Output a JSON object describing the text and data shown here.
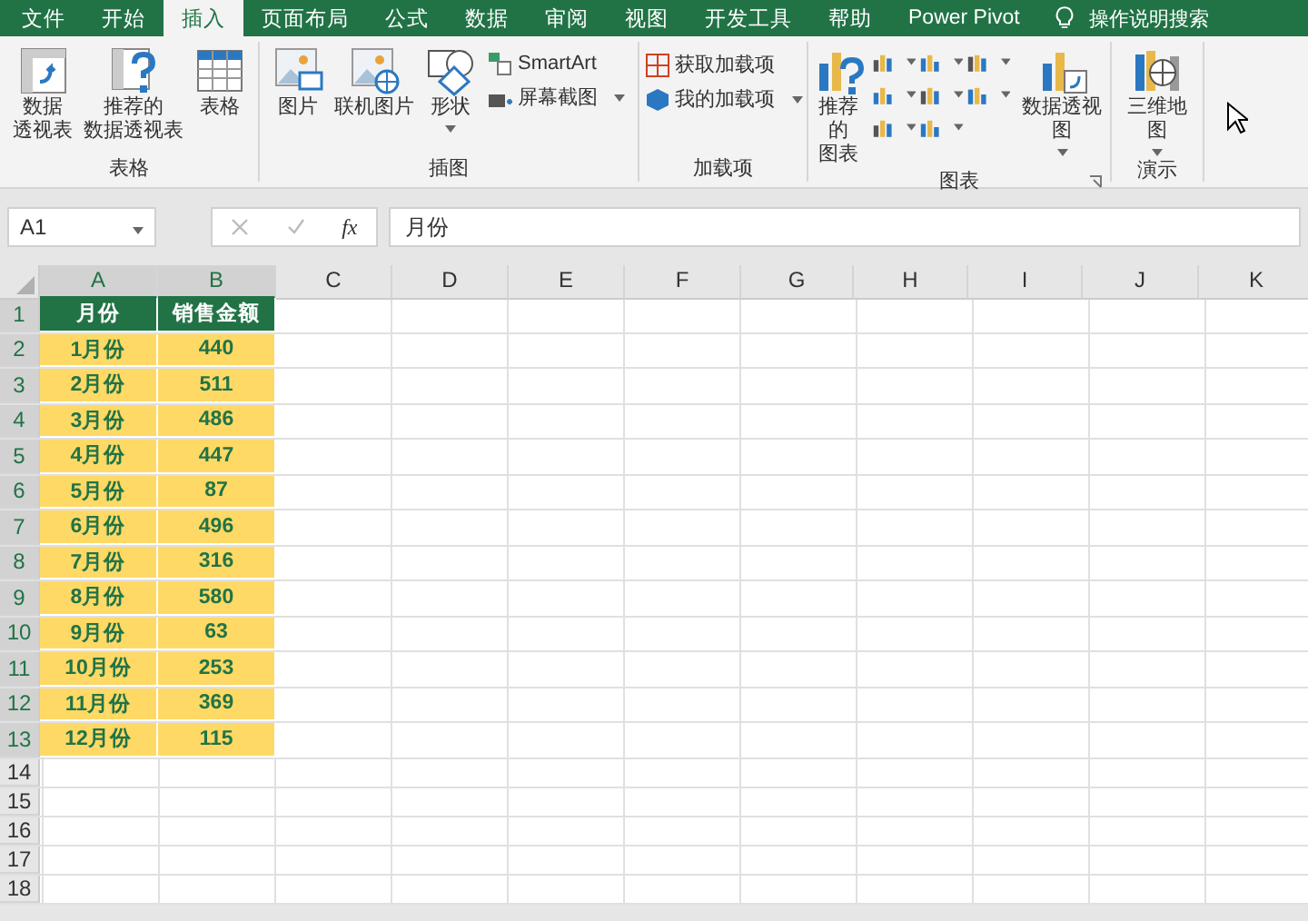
{
  "tabs": [
    {
      "label": "文件",
      "selected": false
    },
    {
      "label": "开始",
      "selected": false
    },
    {
      "label": "插入",
      "selected": true
    },
    {
      "label": "页面布局",
      "selected": false
    },
    {
      "label": "公式",
      "selected": false
    },
    {
      "label": "数据",
      "selected": false
    },
    {
      "label": "审阅",
      "selected": false
    },
    {
      "label": "视图",
      "selected": false
    },
    {
      "label": "开发工具",
      "selected": false
    },
    {
      "label": "帮助",
      "selected": false
    },
    {
      "label": "Power Pivot",
      "selected": false
    }
  ],
  "tell_me": "操作说明搜索",
  "ribbon": {
    "groups": [
      {
        "label": "表格",
        "large": [
          {
            "lines": [
              "数据",
              "透视表"
            ],
            "dropdown": false
          },
          {
            "lines": [
              "推荐的",
              "数据透视表"
            ],
            "dropdown": false
          },
          {
            "lines": [
              "表格"
            ],
            "dropdown": false
          }
        ]
      },
      {
        "label": "插图",
        "large": [
          {
            "lines": [
              "图片"
            ],
            "dropdown": false
          },
          {
            "lines": [
              "联机图片"
            ],
            "dropdown": false
          },
          {
            "lines": [
              "形状"
            ],
            "dropdown": true
          }
        ],
        "small": [
          {
            "label": "SmartArt",
            "dropdown": false
          },
          {
            "label": "屏幕截图",
            "dropdown": true
          }
        ]
      },
      {
        "label": "加载项",
        "small": [
          {
            "label": "获取加载项",
            "dropdown": false
          },
          {
            "label": "我的加载项",
            "dropdown": true
          }
        ]
      },
      {
        "label": "图表",
        "large": [
          {
            "lines": [
              "推荐的",
              "图表"
            ],
            "dropdown": false
          },
          {
            "lines": [
              "数据透视图"
            ],
            "dropdown": true
          }
        ],
        "launcher": true
      },
      {
        "label": "演示",
        "large": [
          {
            "lines": [
              "三维地",
              "图"
            ],
            "dropdown": true
          }
        ]
      }
    ]
  },
  "formula_bar": {
    "name_box": "A1",
    "fx": "fx",
    "formula": "月份"
  },
  "sheet": {
    "columns": [
      {
        "label": "A",
        "highlighted": true
      },
      {
        "label": "B",
        "highlighted": true
      },
      {
        "label": "C",
        "highlighted": false
      },
      {
        "label": "D",
        "highlighted": false
      },
      {
        "label": "E",
        "highlighted": false
      },
      {
        "label": "F",
        "highlighted": false
      },
      {
        "label": "G",
        "highlighted": false
      },
      {
        "label": "H",
        "highlighted": false
      },
      {
        "label": "I",
        "highlighted": false
      },
      {
        "label": "J",
        "highlighted": false
      },
      {
        "label": "K",
        "highlighted": false
      }
    ],
    "rows": [
      {
        "number": "1",
        "highlighted": true,
        "cells": [
          "月份",
          "销售金额"
        ]
      },
      {
        "number": "2",
        "highlighted": true,
        "cells": [
          "1月份",
          "440"
        ]
      },
      {
        "number": "3",
        "highlighted": true,
        "cells": [
          "2月份",
          "511"
        ]
      },
      {
        "number": "4",
        "highlighted": true,
        "cells": [
          "3月份",
          "486"
        ]
      },
      {
        "number": "5",
        "highlighted": true,
        "cells": [
          "4月份",
          "447"
        ]
      },
      {
        "number": "6",
        "highlighted": true,
        "cells": [
          "5月份",
          "87"
        ]
      },
      {
        "number": "7",
        "highlighted": true,
        "cells": [
          "6月份",
          "496"
        ]
      },
      {
        "number": "8",
        "highlighted": true,
        "cells": [
          "7月份",
          "316"
        ]
      },
      {
        "number": "9",
        "highlighted": true,
        "cells": [
          "8月份",
          "580"
        ]
      },
      {
        "number": "10",
        "highlighted": true,
        "cells": [
          "9月份",
          "63"
        ]
      },
      {
        "number": "11",
        "highlighted": true,
        "cells": [
          "10月份",
          "253"
        ]
      },
      {
        "number": "12",
        "highlighted": true,
        "cells": [
          "11月份",
          "369"
        ]
      },
      {
        "number": "13",
        "highlighted": true,
        "cells": [
          "12月份",
          "115"
        ]
      },
      {
        "number": "14",
        "highlighted": false
      },
      {
        "number": "15",
        "highlighted": false
      },
      {
        "number": "16",
        "highlighted": false
      },
      {
        "number": "17",
        "highlighted": false
      },
      {
        "number": "18",
        "highlighted": false
      }
    ]
  }
}
